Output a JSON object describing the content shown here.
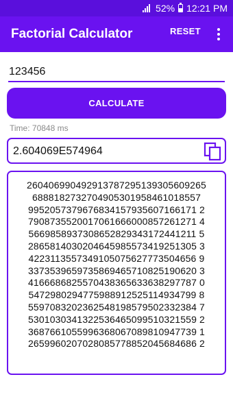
{
  "status_bar": {
    "battery": "52%",
    "time": "12:21 PM"
  },
  "app_bar": {
    "title": "Factorial Calculator",
    "reset_label": "RESET"
  },
  "input": {
    "value": "123456"
  },
  "calculate_label": "CALCULATE",
  "time_label": "Time: 70848 ms",
  "result": "2.604069E574964",
  "full_result_lines": [
    "260406990492913787295139305609265",
    "6888182732704905301958461018557",
    "9952057379676834157935607166171 2",
    "7908735520017061666000857261271 4",
    "5669858937308652829343172441211 5",
    "2865814030204645985573419251305 3",
    "4223113557349105075627773504656 9",
    "3373539659735869465710825190620 3",
    "4166686825570438365633638297787 0",
    "5472980294775988912525114934799 8",
    "5597083202362548198579502332384 7",
    "5301030341322536465099510321559 2",
    "3687661055996368067089810947739 1",
    "2659960207028085778852045684686 2"
  ]
}
